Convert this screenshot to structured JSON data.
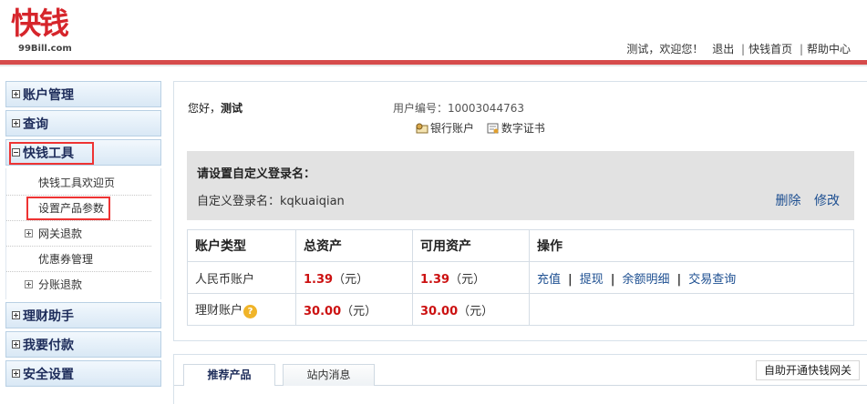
{
  "header": {
    "logo_text": "快钱",
    "logo_sub": "99Bill.com",
    "greeting": "测试，欢迎您！",
    "logout": "退出",
    "home": "快钱首页",
    "help": "帮助中心",
    "sep": "|"
  },
  "sidebar": {
    "account_mgmt": "账户管理",
    "query": "查询",
    "tools": "快钱工具",
    "tools_items": [
      "快钱工具欢迎页",
      "设置产品参数",
      "网关退款",
      "优惠券管理",
      "分账退款"
    ],
    "finance": "理财助手",
    "pay": "我要付款",
    "security": "安全设置"
  },
  "main": {
    "hello_prefix": "您好，",
    "hello_name": "测试",
    "account_no": "用户编号：10003044763",
    "bank_account": "银行账户",
    "digital_cert": "数字证书",
    "login_title": "请设置自定义登录名：",
    "login_label": "自定义登录名：kqkuaiqian",
    "delete": "删除",
    "modify": "修改"
  },
  "table": {
    "headers": [
      "账户类型",
      "总资产",
      "可用资产",
      "操作"
    ],
    "rows": [
      {
        "type": "人民币账户",
        "total": "1.39",
        "available": "1.39",
        "unit": "（元）"
      },
      {
        "type": "理财账户",
        "total": "30.00",
        "available": "30.00",
        "unit": "（元）"
      }
    ],
    "ops": [
      "充值",
      "提现",
      "余额明细",
      "交易查询"
    ],
    "ops_sep": "|",
    "help_icon": "?"
  },
  "bottom": {
    "tab_recommended": "推荐产品",
    "tab_messages": "站内消息",
    "gateway_link": "自助开通快钱网关"
  },
  "colors": {
    "brand_red": "#d6252b",
    "link_blue": "#1d4f91",
    "highlight_red": "#ee3333"
  }
}
